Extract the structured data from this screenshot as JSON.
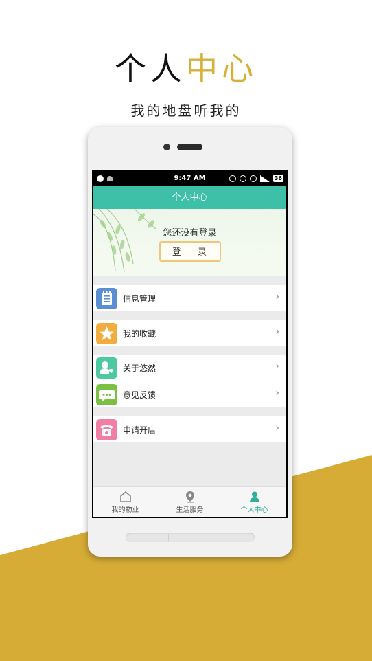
{
  "promo": {
    "title_black": "个人",
    "title_gold": "中心",
    "subtitle": "我的地盘听我的"
  },
  "status_bar": {
    "time": "9:47 AM",
    "battery": "36"
  },
  "header": {
    "title": "个人中心"
  },
  "login_card": {
    "message": "您还没有登录",
    "login_button": "登 录"
  },
  "menu": [
    {
      "label": "信息管理",
      "icon": "notepad-icon",
      "color": "#5b8fd3"
    },
    {
      "label": "我的收藏",
      "icon": "star-icon",
      "color": "#f2ac3e"
    },
    {
      "label": "关于悠然",
      "icon": "person-heart-icon",
      "color": "#4cc9a0"
    },
    {
      "label": "意见反馈",
      "icon": "chat-bubble-icon",
      "color": "#7ac143"
    },
    {
      "label": "申请开店",
      "icon": "telephone-icon",
      "color": "#f07fa3"
    }
  ],
  "tabs": [
    {
      "label": "我的物业",
      "icon": "house-icon",
      "active": false
    },
    {
      "label": "生活服务",
      "icon": "location-pin-icon",
      "active": false
    },
    {
      "label": "个人中心",
      "icon": "person-icon",
      "active": true
    }
  ],
  "colors": {
    "accent": "#3ebfa8",
    "gold": "#d6b13a"
  }
}
